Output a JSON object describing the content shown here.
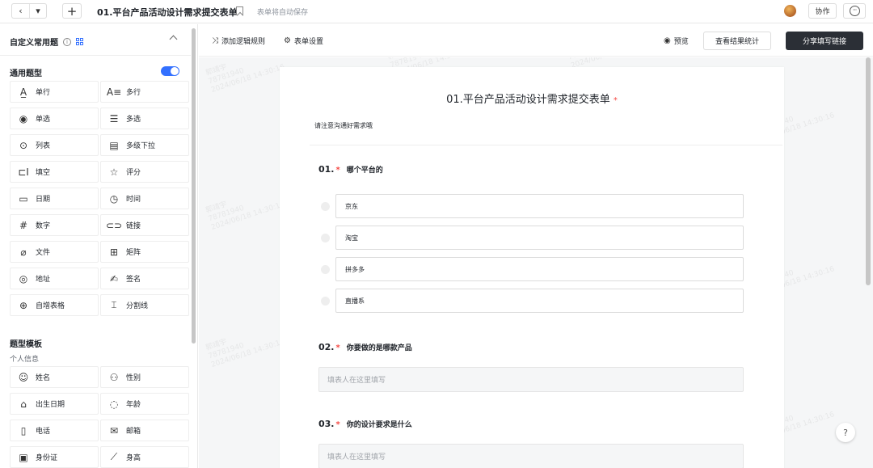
{
  "topbar": {
    "back_label": "‹",
    "dropdown_label": "▾",
    "add_label": "+",
    "title": "01.平台产品活动设计需求提交表单",
    "autosave_text": "表单将自动保存",
    "collab_label": "协作",
    "more_label": "···"
  },
  "sidebar": {
    "header": "自定义常用题",
    "info_label": "i",
    "general_title": "通用题型",
    "template_title": "题型模板",
    "personal_info": "个人信息",
    "general_types": [
      {
        "label": "单行",
        "icon": "single-line-icon",
        "glyph": "A̲"
      },
      {
        "label": "多行",
        "icon": "multi-line-icon",
        "glyph": "A≡"
      },
      {
        "label": "单选",
        "icon": "radio-icon",
        "glyph": "◉"
      },
      {
        "label": "多选",
        "icon": "checklist-icon",
        "glyph": "☰"
      },
      {
        "label": "列表",
        "icon": "dropdown-list-icon",
        "glyph": "⊙"
      },
      {
        "label": "多级下拉",
        "icon": "cascade-dropdown-icon",
        "glyph": "▤"
      },
      {
        "label": "填空",
        "icon": "fill-blank-icon",
        "glyph": "⊏I"
      },
      {
        "label": "评分",
        "icon": "star-icon",
        "glyph": "☆"
      },
      {
        "label": "日期",
        "icon": "calendar-icon",
        "glyph": "▭"
      },
      {
        "label": "时间",
        "icon": "clock-icon",
        "glyph": "◷"
      },
      {
        "label": "数字",
        "icon": "hash-icon",
        "glyph": "#"
      },
      {
        "label": "链接",
        "icon": "link-icon",
        "glyph": "⊂⊃"
      },
      {
        "label": "文件",
        "icon": "paperclip-icon",
        "glyph": "⌀"
      },
      {
        "label": "矩阵",
        "icon": "matrix-icon",
        "glyph": "⊞"
      },
      {
        "label": "地址",
        "icon": "location-pin-icon",
        "glyph": "◎"
      },
      {
        "label": "签名",
        "icon": "signature-icon",
        "glyph": "✍"
      },
      {
        "label": "自增表格",
        "icon": "table-add-icon",
        "glyph": "⊕"
      },
      {
        "label": "分割线",
        "icon": "divider-icon",
        "glyph": "⌶"
      }
    ],
    "template_types": [
      {
        "label": "姓名",
        "icon": "user-circle-icon",
        "glyph": "☺"
      },
      {
        "label": "性别",
        "icon": "gender-icon",
        "glyph": "⚇"
      },
      {
        "label": "出生日期",
        "icon": "cake-icon",
        "glyph": "⌂"
      },
      {
        "label": "年龄",
        "icon": "age-icon",
        "glyph": "◌"
      },
      {
        "label": "电话",
        "icon": "phone-icon",
        "glyph": "▯"
      },
      {
        "label": "邮箱",
        "icon": "mail-icon",
        "glyph": "✉"
      },
      {
        "label": "身份证",
        "icon": "id-card-icon",
        "glyph": "▣"
      },
      {
        "label": "身高",
        "icon": "ruler-icon",
        "glyph": "⟋"
      }
    ]
  },
  "toolbar": {
    "logic_label": "添加逻辑规则",
    "settings_label": "表单设置",
    "preview_label": "预览",
    "stats_label": "查看结果统计",
    "share_label": "分享填写链接"
  },
  "form": {
    "title": "01.平台产品活动设计需求提交表单",
    "required_mark": "*",
    "description": "请注意沟通好需求哦",
    "questions": [
      {
        "number": "01.",
        "text": "哪个平台的",
        "options": [
          "京东",
          "淘宝",
          "拼多多",
          "直播系"
        ]
      },
      {
        "number": "02.",
        "text": "你要做的是哪款产品",
        "placeholder": "填表人在这里填写"
      },
      {
        "number": "03.",
        "text": "你的设计要求是什么",
        "placeholder": "填表人在这里填写"
      }
    ]
  },
  "watermark": "郭靖宇\n78781940\n2024/06/18 14:30:16",
  "help_label": "?"
}
